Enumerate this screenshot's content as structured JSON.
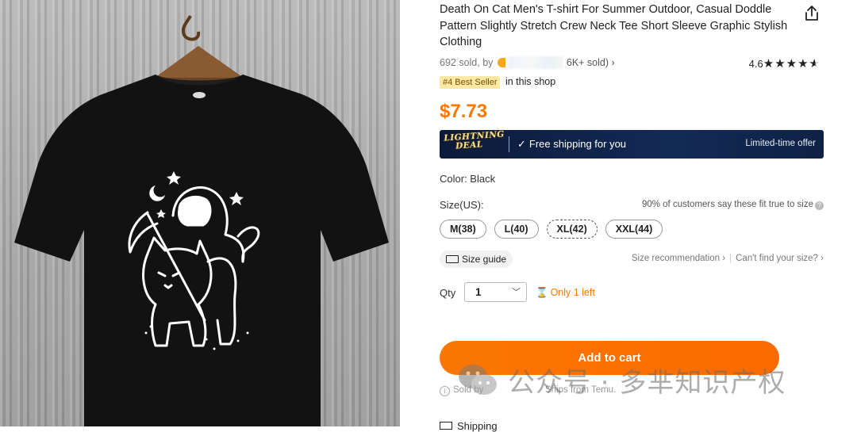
{
  "product": {
    "title": "Death On Cat Men's T-shirt For Summer Outdoor, Casual Doddle Pattern Slightly Stretch Crew Neck Tee Short Sleeve Graphic Stylish Clothing",
    "sold_text": "692 sold, by",
    "shop_sold_text": "6K+ sold)",
    "rating_value": "4.6",
    "rating_stars": 4.6,
    "best_seller_badge": "#4 Best Seller",
    "best_seller_suffix": "in this shop",
    "price": "$7.73"
  },
  "deal_banner": {
    "logo_line1": "LIGHTNING",
    "logo_line2": "DEAL",
    "shipping_text": "Free shipping for you",
    "limited_text": "Limited-time offer"
  },
  "color": {
    "label": "Color: Black"
  },
  "size": {
    "label": "Size(US):",
    "fit_note": "90% of customers say these fit true to size",
    "options": [
      "M(38)",
      "L(40)",
      "XL(42)",
      "XXL(44)"
    ],
    "selected": "XL(42)",
    "guide_label": "Size guide",
    "recommendation_label": "Size recommendation",
    "cant_find_label": "Can't find your size?"
  },
  "quantity": {
    "label": "Qty",
    "value": "1",
    "stock_text": "Only 1 left"
  },
  "actions": {
    "add_to_cart": "Add to cart"
  },
  "sold_by": {
    "label": "Sold by",
    "ships_from": "Ships from Temu."
  },
  "shipping": {
    "label": "Shipping"
  },
  "watermark": {
    "text": "公众号 · 多芈知识产权"
  },
  "colors": {
    "accent": "#fb7701",
    "banner_bg": "#0b1a3a",
    "badge_bg": "#fde9a6",
    "shirt": "#101010",
    "background_image": "#a8a8a8"
  }
}
